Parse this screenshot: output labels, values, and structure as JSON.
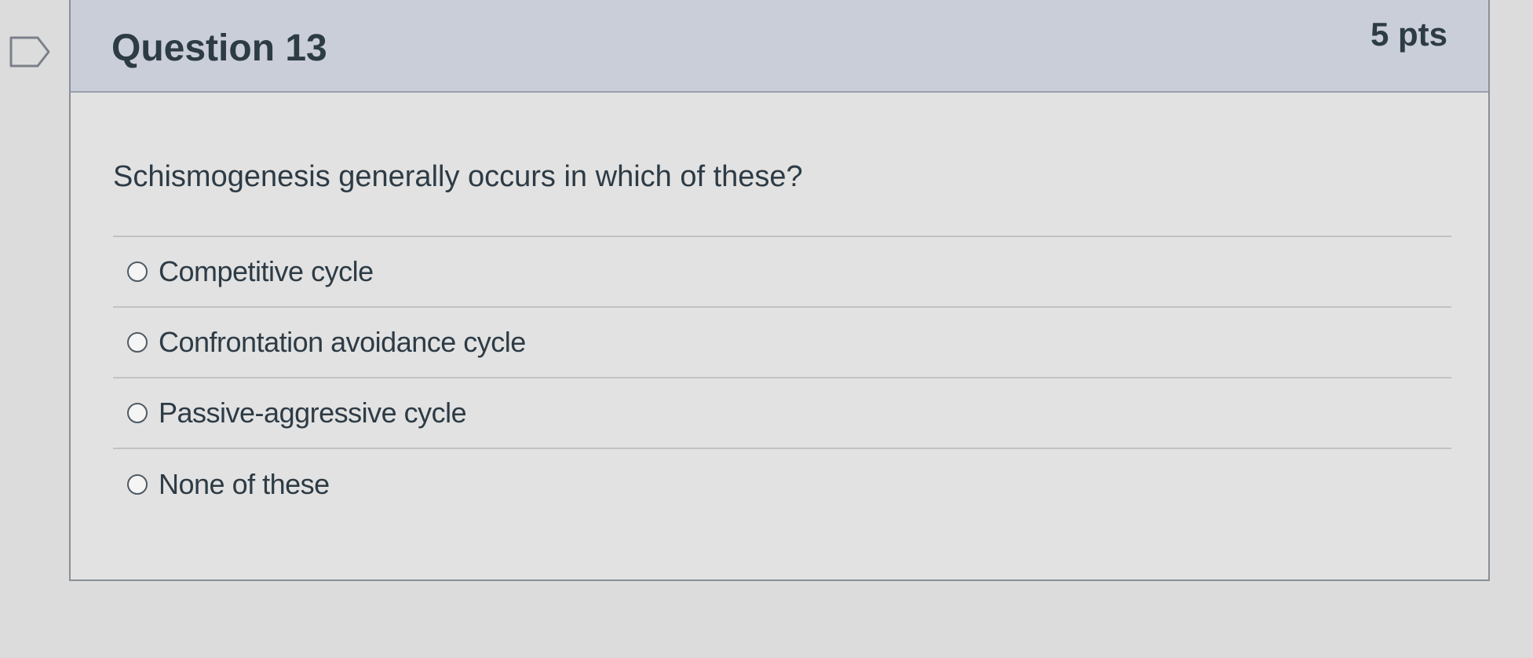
{
  "question": {
    "title": "Question 13",
    "points": "5 pts",
    "text": "Schismogenesis generally occurs in which of these?"
  },
  "answers": [
    {
      "label": "Competitive cycle"
    },
    {
      "label": "Confrontation avoidance cycle"
    },
    {
      "label": "Passive-aggressive cycle"
    },
    {
      "label": "None of these"
    }
  ],
  "icons": {
    "flag": "flag-question-icon"
  },
  "colors": {
    "header_background": "#c9ced9",
    "text": "#2d3b45"
  }
}
